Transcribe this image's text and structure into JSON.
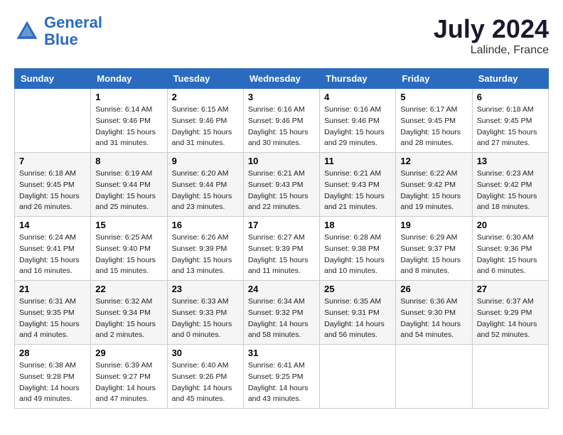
{
  "header": {
    "logo_line1": "General",
    "logo_line2": "Blue",
    "month_year": "July 2024",
    "location": "Lalinde, France"
  },
  "days_of_week": [
    "Sunday",
    "Monday",
    "Tuesday",
    "Wednesday",
    "Thursday",
    "Friday",
    "Saturday"
  ],
  "weeks": [
    [
      {
        "day": "",
        "info": ""
      },
      {
        "day": "1",
        "info": "Sunrise: 6:14 AM\nSunset: 9:46 PM\nDaylight: 15 hours\nand 31 minutes."
      },
      {
        "day": "2",
        "info": "Sunrise: 6:15 AM\nSunset: 9:46 PM\nDaylight: 15 hours\nand 31 minutes."
      },
      {
        "day": "3",
        "info": "Sunrise: 6:16 AM\nSunset: 9:46 PM\nDaylight: 15 hours\nand 30 minutes."
      },
      {
        "day": "4",
        "info": "Sunrise: 6:16 AM\nSunset: 9:46 PM\nDaylight: 15 hours\nand 29 minutes."
      },
      {
        "day": "5",
        "info": "Sunrise: 6:17 AM\nSunset: 9:45 PM\nDaylight: 15 hours\nand 28 minutes."
      },
      {
        "day": "6",
        "info": "Sunrise: 6:18 AM\nSunset: 9:45 PM\nDaylight: 15 hours\nand 27 minutes."
      }
    ],
    [
      {
        "day": "7",
        "info": "Sunrise: 6:18 AM\nSunset: 9:45 PM\nDaylight: 15 hours\nand 26 minutes."
      },
      {
        "day": "8",
        "info": "Sunrise: 6:19 AM\nSunset: 9:44 PM\nDaylight: 15 hours\nand 25 minutes."
      },
      {
        "day": "9",
        "info": "Sunrise: 6:20 AM\nSunset: 9:44 PM\nDaylight: 15 hours\nand 23 minutes."
      },
      {
        "day": "10",
        "info": "Sunrise: 6:21 AM\nSunset: 9:43 PM\nDaylight: 15 hours\nand 22 minutes."
      },
      {
        "day": "11",
        "info": "Sunrise: 6:21 AM\nSunset: 9:43 PM\nDaylight: 15 hours\nand 21 minutes."
      },
      {
        "day": "12",
        "info": "Sunrise: 6:22 AM\nSunset: 9:42 PM\nDaylight: 15 hours\nand 19 minutes."
      },
      {
        "day": "13",
        "info": "Sunrise: 6:23 AM\nSunset: 9:42 PM\nDaylight: 15 hours\nand 18 minutes."
      }
    ],
    [
      {
        "day": "14",
        "info": "Sunrise: 6:24 AM\nSunset: 9:41 PM\nDaylight: 15 hours\nand 16 minutes."
      },
      {
        "day": "15",
        "info": "Sunrise: 6:25 AM\nSunset: 9:40 PM\nDaylight: 15 hours\nand 15 minutes."
      },
      {
        "day": "16",
        "info": "Sunrise: 6:26 AM\nSunset: 9:39 PM\nDaylight: 15 hours\nand 13 minutes."
      },
      {
        "day": "17",
        "info": "Sunrise: 6:27 AM\nSunset: 9:39 PM\nDaylight: 15 hours\nand 11 minutes."
      },
      {
        "day": "18",
        "info": "Sunrise: 6:28 AM\nSunset: 9:38 PM\nDaylight: 15 hours\nand 10 minutes."
      },
      {
        "day": "19",
        "info": "Sunrise: 6:29 AM\nSunset: 9:37 PM\nDaylight: 15 hours\nand 8 minutes."
      },
      {
        "day": "20",
        "info": "Sunrise: 6:30 AM\nSunset: 9:36 PM\nDaylight: 15 hours\nand 6 minutes."
      }
    ],
    [
      {
        "day": "21",
        "info": "Sunrise: 6:31 AM\nSunset: 9:35 PM\nDaylight: 15 hours\nand 4 minutes."
      },
      {
        "day": "22",
        "info": "Sunrise: 6:32 AM\nSunset: 9:34 PM\nDaylight: 15 hours\nand 2 minutes."
      },
      {
        "day": "23",
        "info": "Sunrise: 6:33 AM\nSunset: 9:33 PM\nDaylight: 15 hours\nand 0 minutes."
      },
      {
        "day": "24",
        "info": "Sunrise: 6:34 AM\nSunset: 9:32 PM\nDaylight: 14 hours\nand 58 minutes."
      },
      {
        "day": "25",
        "info": "Sunrise: 6:35 AM\nSunset: 9:31 PM\nDaylight: 14 hours\nand 56 minutes."
      },
      {
        "day": "26",
        "info": "Sunrise: 6:36 AM\nSunset: 9:30 PM\nDaylight: 14 hours\nand 54 minutes."
      },
      {
        "day": "27",
        "info": "Sunrise: 6:37 AM\nSunset: 9:29 PM\nDaylight: 14 hours\nand 52 minutes."
      }
    ],
    [
      {
        "day": "28",
        "info": "Sunrise: 6:38 AM\nSunset: 9:28 PM\nDaylight: 14 hours\nand 49 minutes."
      },
      {
        "day": "29",
        "info": "Sunrise: 6:39 AM\nSunset: 9:27 PM\nDaylight: 14 hours\nand 47 minutes."
      },
      {
        "day": "30",
        "info": "Sunrise: 6:40 AM\nSunset: 9:26 PM\nDaylight: 14 hours\nand 45 minutes."
      },
      {
        "day": "31",
        "info": "Sunrise: 6:41 AM\nSunset: 9:25 PM\nDaylight: 14 hours\nand 43 minutes."
      },
      {
        "day": "",
        "info": ""
      },
      {
        "day": "",
        "info": ""
      },
      {
        "day": "",
        "info": ""
      }
    ]
  ]
}
